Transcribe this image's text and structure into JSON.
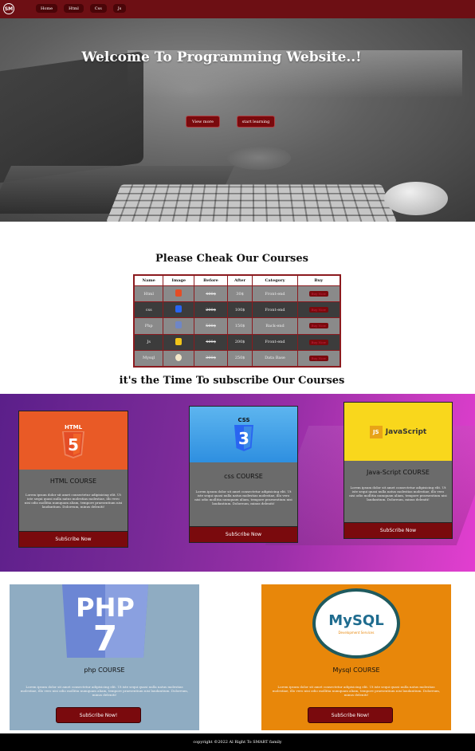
{
  "navbar": {
    "logo": "SM",
    "items": [
      {
        "label": "Home"
      },
      {
        "label": "Html"
      },
      {
        "label": "Css"
      },
      {
        "label": "Js"
      }
    ]
  },
  "hero": {
    "title": "Welcome To Programming Website..!",
    "view_button": "View more",
    "start_button": "start learning"
  },
  "courses": {
    "title": "Please Cheak Our Courses",
    "headers": [
      "Name",
      "Image",
      "Before",
      "After",
      "Category",
      "Buy"
    ],
    "rows": [
      {
        "name": "Html",
        "before": "400$",
        "after": "30$",
        "category": "Front-end",
        "buy": "Buy Now"
      },
      {
        "name": "css",
        "before": "200$",
        "after": "100$",
        "category": "Front-end",
        "buy": "Buy Now"
      },
      {
        "name": "Php",
        "before": "500$",
        "after": "150$",
        "category": "Back-end",
        "buy": "Buy Now"
      },
      {
        "name": "Js",
        "before": "400$",
        "after": "200$",
        "category": "Front-end",
        "buy": "Buy Now"
      },
      {
        "name": "Mysql",
        "before": "300$",
        "after": "250$",
        "category": "Data Base",
        "buy": "Buy Now"
      }
    ]
  },
  "subscribe": {
    "title": "it's the Time To subscribe Our Courses",
    "lorem": "Lorem ipsum dolor sit amet consectetur adipisicing elit. Ut iste sequi quasi nulla natus molestias molestiae, illo vero nisi odio mollitia numquam aliam, tempore praesentium nisi laudantium. Doloreum, minus deleniti!",
    "cards": [
      {
        "title": "HTML COURSE",
        "button": "SubScribe Now",
        "badge": "HTML",
        "digit": "5"
      },
      {
        "title": "css COURSE",
        "button": "SubScribe Now",
        "badge": "CSS",
        "digit": "3"
      },
      {
        "title": "Java-Script COURSE",
        "button": "SubScribe Now",
        "badge": "JS",
        "logo_text": "JavaScript"
      }
    ]
  },
  "bottom": {
    "lorem": "Lorem ipsum dolor sit amet consectetur adipisicing elit. Ut iste sequi quasi nulla natus molestias molestiae, illo vero nisi odio mollitia numquam aliam, tempore praesentium nisi laudantium. Doloreum, minus deleniti!",
    "cards": [
      {
        "title": "php COURSE",
        "button": "SubScribe Now!",
        "logo": "PHP",
        "logo_digit": "7"
      },
      {
        "title": "Mysql COURSE",
        "button": "SubScribe Now!",
        "logo": "MySQL",
        "logo_sub": "Development Services"
      }
    ]
  },
  "footer": {
    "text": "copyright ©2022 Al Right To SMART family"
  },
  "colors": {
    "nav": "#6d0f14",
    "button": "#7a0a0d",
    "html_orange": "#e44d26",
    "css_blue": "#2965f1",
    "js_yellow": "#f7df1e",
    "php_bg": "#8facc2",
    "mysql_bg": "#e8870a"
  }
}
